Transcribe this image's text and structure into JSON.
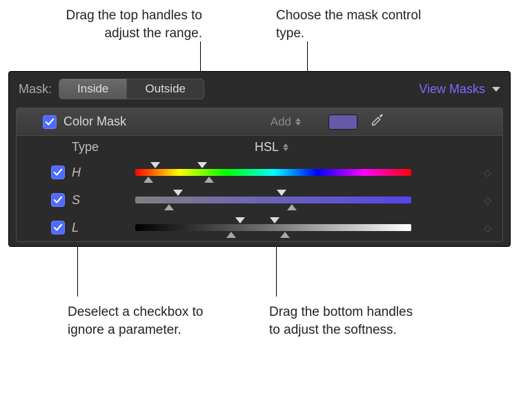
{
  "callouts": {
    "top_left": "Drag the top handles to adjust the range.",
    "top_right": "Choose the mask control type.",
    "bottom_left": "Deselect a checkbox to ignore a parameter.",
    "bottom_right": "Drag the bottom handles to adjust the softness."
  },
  "panel": {
    "mask_label": "Mask:",
    "seg_inside": "Inside",
    "seg_outside": "Outside",
    "view_masks": "View Masks",
    "header_label": "Color Mask",
    "add_label": "Add",
    "type_label": "Type",
    "type_value": "HSL",
    "params": {
      "h": "H",
      "s": "S",
      "l": "L"
    }
  }
}
